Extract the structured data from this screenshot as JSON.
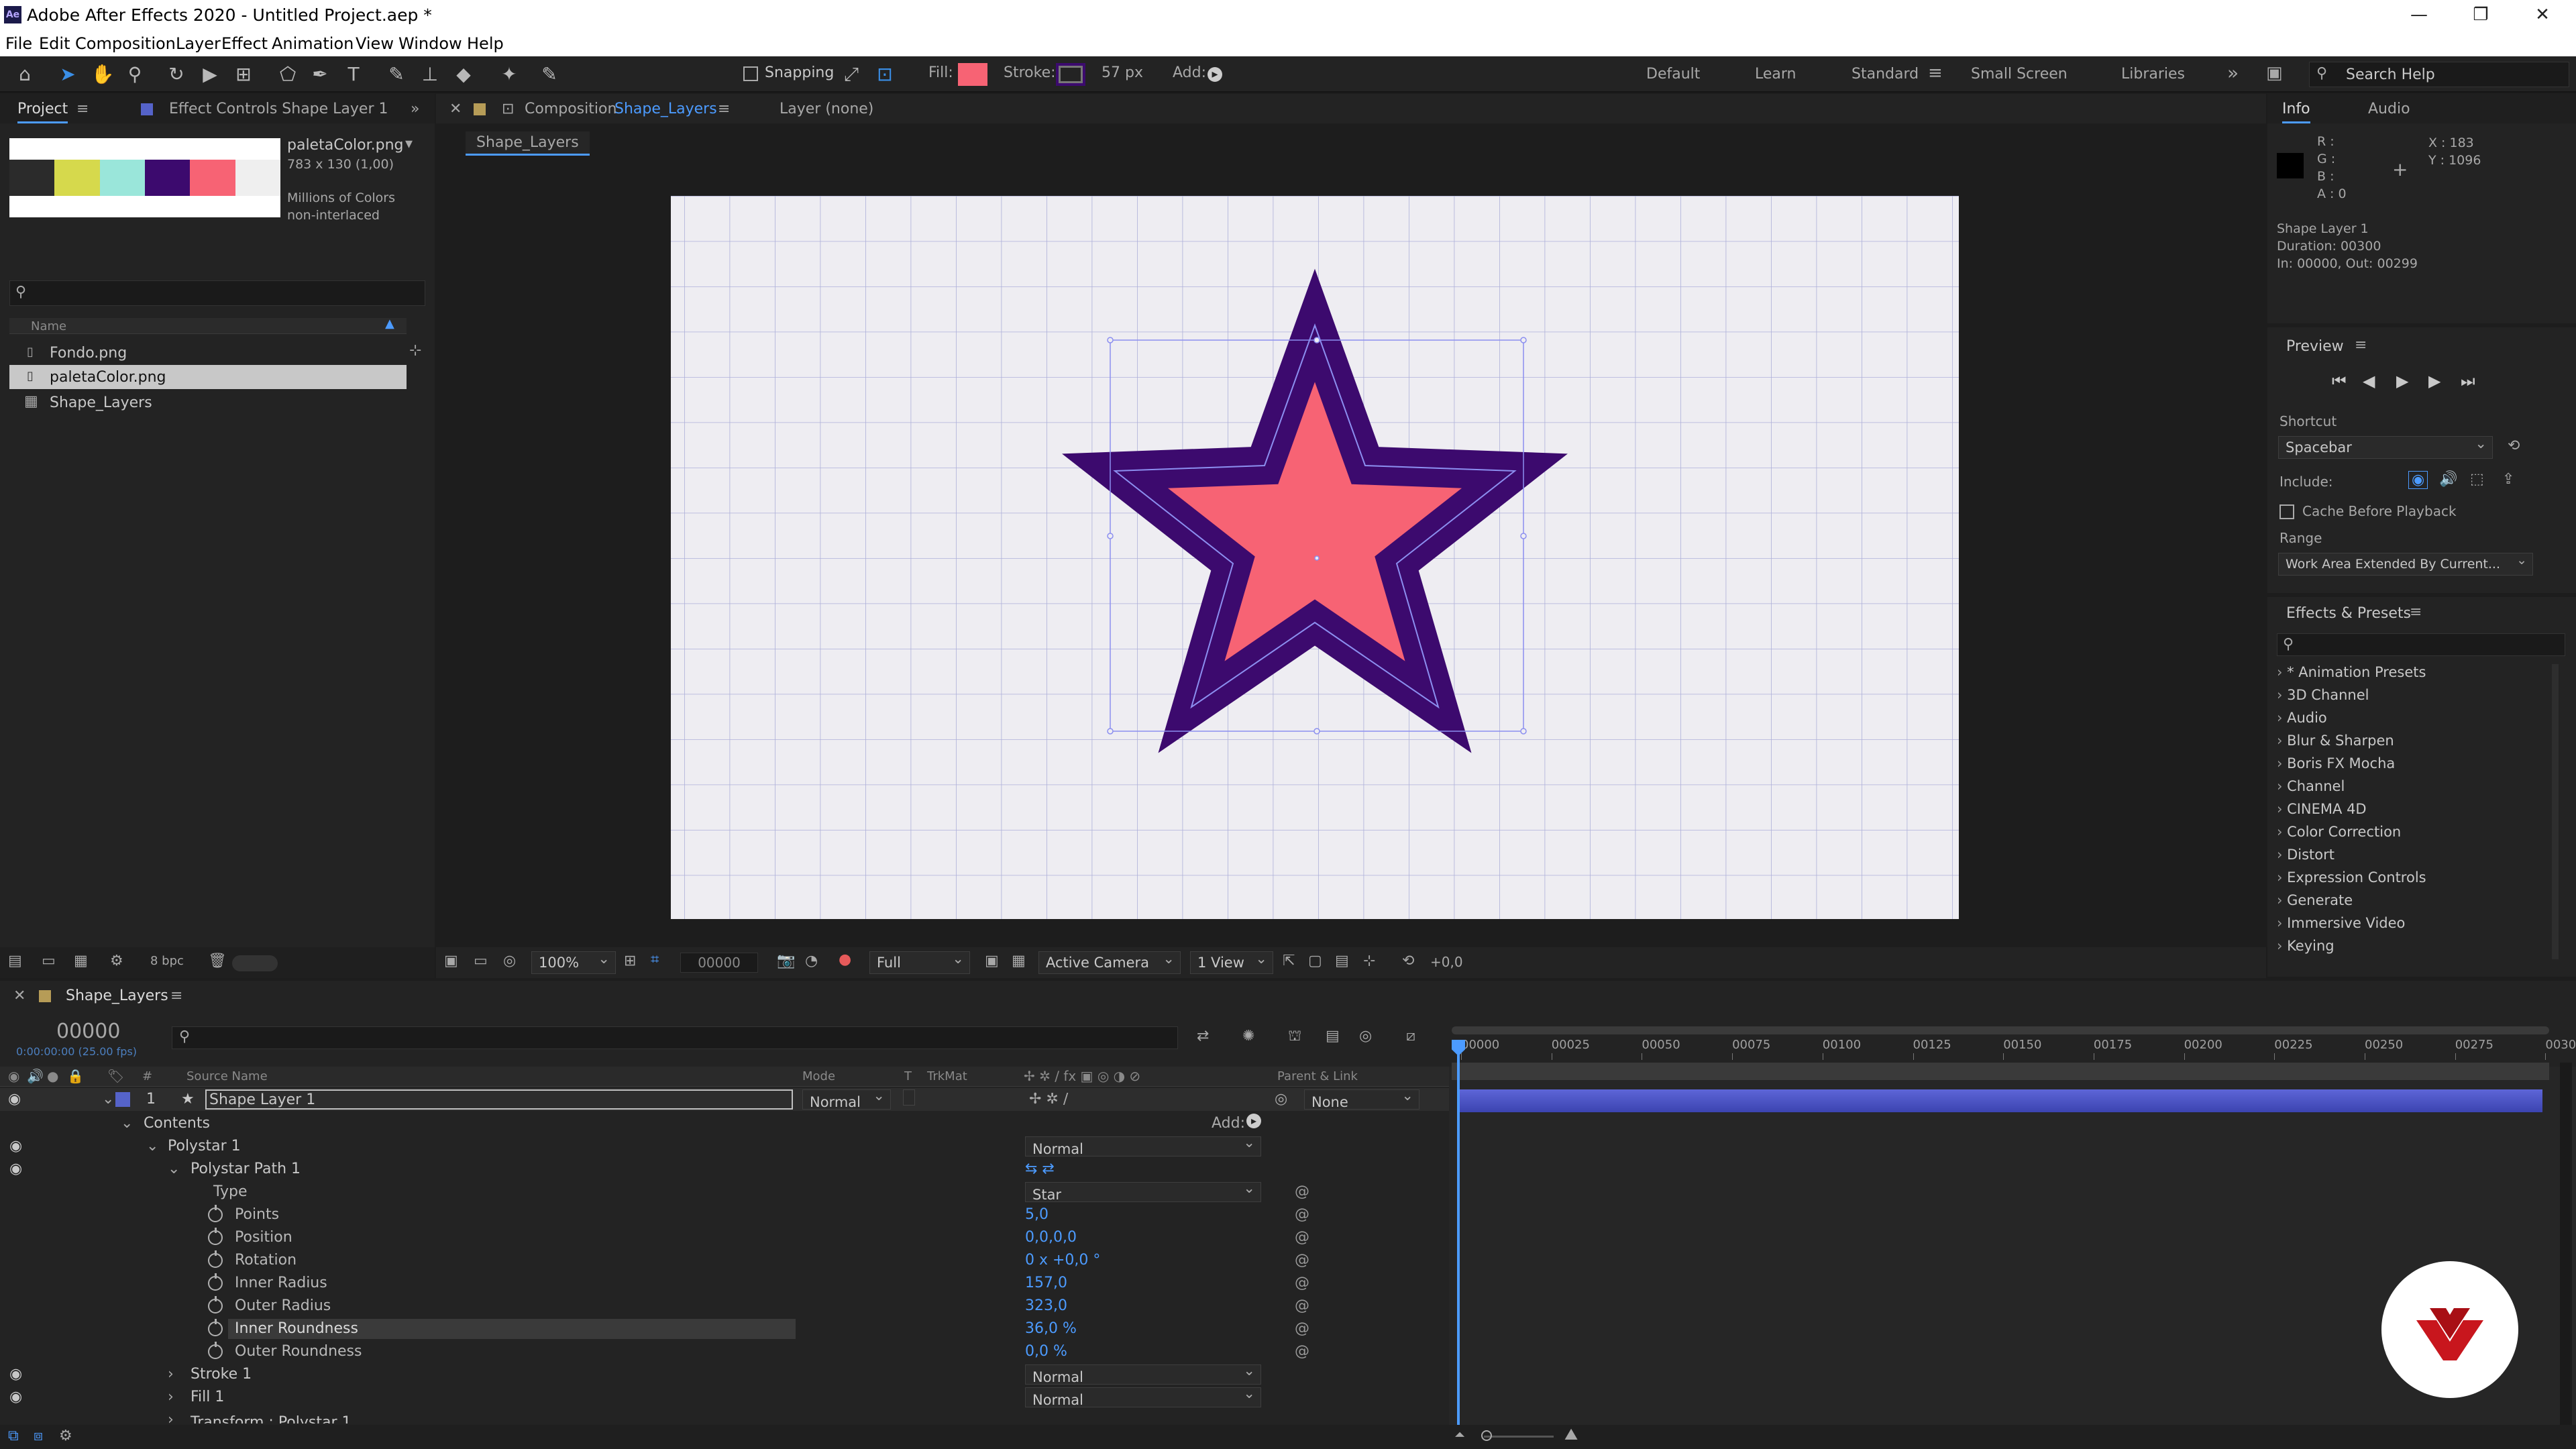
{
  "window": {
    "title": "Adobe After Effects 2020 - Untitled Project.aep *",
    "app_icon": "Ae"
  },
  "menu": [
    "File",
    "Edit",
    "Composition",
    "Layer",
    "Effect",
    "Animation",
    "View",
    "Window",
    "Help"
  ],
  "toolbar": {
    "snapping": "Snapping",
    "fill_label": "Fill:",
    "stroke_label": "Stroke:",
    "stroke_px": "57 px",
    "add_label": "Add:",
    "fill_color": "#f76374",
    "stroke_color": "#3c0a6e"
  },
  "workspaces": [
    "Default",
    "Learn",
    "Standard",
    "Small Screen",
    "Libraries"
  ],
  "search_help": "Search Help",
  "project": {
    "tab": "Project",
    "effect_tab": "Effect Controls Shape Layer 1",
    "preview_name": "paletaColor.png",
    "preview_dims": "783 x 130 (1,00)",
    "preview_colors": "Millions of Colors",
    "preview_interlace": "non-interlaced",
    "palette": [
      "#2b2b2b",
      "#d6d94c",
      "#9ae6da",
      "#3c0a6e",
      "#f76374",
      "#efefef"
    ],
    "name_col": "Name",
    "items": [
      "Fondo.png",
      "paletaColor.png",
      "Shape_Layers"
    ],
    "bpc": "8 bpc"
  },
  "comp": {
    "tab_prefix": "Composition",
    "tab_name": "Shape_Layers",
    "layer_tab": "Layer (none)",
    "breadcrumb": "Shape_Layers",
    "zoom": "100%",
    "timecode": "00000",
    "resolution": "Full",
    "camera": "Active Camera",
    "view": "1 View",
    "exposure": "+0,0"
  },
  "info": {
    "tab": "Info",
    "audio_tab": "Audio",
    "r": "R :",
    "g": "G :",
    "b": "B :",
    "a": "A :  0",
    "x": "X : 183",
    "y": "Y : 1096",
    "layer": "Shape Layer 1",
    "duration": "Duration: 00300",
    "inout": "In: 00000, Out: 00299"
  },
  "preview": {
    "title": "Preview",
    "shortcut_label": "Shortcut",
    "shortcut": "Spacebar",
    "include": "Include:",
    "cache": "Cache Before Playback",
    "range_label": "Range",
    "range": "Work Area Extended By Current..."
  },
  "effects": {
    "title": "Effects & Presets",
    "items": [
      "* Animation Presets",
      "3D Channel",
      "Audio",
      "Blur & Sharpen",
      "Boris FX Mocha",
      "Channel",
      "CINEMA 4D",
      "Color Correction",
      "Distort",
      "Expression Controls",
      "Generate",
      "Immersive Video",
      "Keying"
    ]
  },
  "timeline": {
    "tab": "Shape_Layers",
    "timecode": "00000",
    "fps": "0:00:00:00 (25.00 fps)",
    "col_source": "Source Name",
    "col_mode": "Mode",
    "col_t": "T",
    "col_trkmat": "TrkMat",
    "col_parent": "Parent & Link",
    "layer_num": "1",
    "layer_name": "Shape Layer 1",
    "layer_mode": "Normal",
    "parent": "None",
    "contents": "Contents",
    "add": "Add:",
    "polystar": "Polystar 1",
    "polystar_mode": "Normal",
    "path": "Polystar Path 1",
    "props": [
      {
        "name": "Type",
        "value": "Star"
      },
      {
        "name": "Points",
        "value": "5,0"
      },
      {
        "name": "Position",
        "value": "0,0,0,0"
      },
      {
        "name": "Rotation",
        "value": "0 x +0,0 °"
      },
      {
        "name": "Inner Radius",
        "value": "157,0"
      },
      {
        "name": "Outer Radius",
        "value": "323,0"
      },
      {
        "name": "Inner Roundness",
        "value": "36,0 %"
      },
      {
        "name": "Outer Roundness",
        "value": "0,0 %"
      }
    ],
    "stroke": "Stroke 1",
    "stroke_mode": "Normal",
    "fill": "Fill 1",
    "fill_mode": "Normal",
    "transform": "Transform : Polystar 1",
    "ruler": [
      "00000",
      "00025",
      "00050",
      "00075",
      "00100",
      "00125",
      "00150",
      "00175",
      "00200",
      "00225",
      "00250",
      "00275",
      "0030"
    ]
  }
}
